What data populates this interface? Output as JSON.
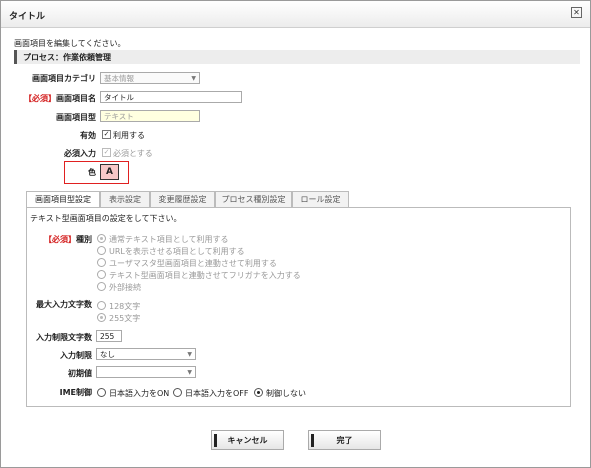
{
  "dialog": {
    "title": "タイトル"
  },
  "instructions": "画面項目を編集してください。",
  "section_title": "プロセス：作業依頼管理",
  "form": {
    "category": {
      "label": "画面項目カテゴリ",
      "value": "基本情報"
    },
    "name": {
      "required": "【必須】",
      "label": "画面項目名",
      "value": "タイトル"
    },
    "type": {
      "label": "画面項目型",
      "value": "テキスト"
    },
    "enabled": {
      "label": "有効",
      "option": "利用する"
    },
    "required_input": {
      "label": "必須入力",
      "option": "必須とする"
    },
    "color": {
      "label": "色",
      "button": "A"
    }
  },
  "tabs": [
    "画面項目型設定",
    "表示設定",
    "変更履歴設定",
    "プロセス種別設定",
    "ロール設定"
  ],
  "panel": {
    "description": "テキスト型画面項目の設定をして下さい。",
    "kind": {
      "required": "【必須】",
      "label": "種別",
      "options": [
        "通常テキスト項目として利用する",
        "URLを表示させる項目として利用する",
        "ユーザマスタ型画面項目と連動させて利用する",
        "テキスト型画面項目と連動させてフリガナを入力する",
        "外部接続"
      ]
    },
    "max_len": {
      "label": "最大入力文字数",
      "options": [
        "128文字",
        "255文字"
      ]
    },
    "limit_len": {
      "label": "入力制限文字数",
      "value": "255"
    },
    "input_limit": {
      "label": "入力制限",
      "value": "なし"
    },
    "initial": {
      "label": "初期値",
      "value": ""
    },
    "ime": {
      "label": "IME制御",
      "options": [
        "日本語入力をON",
        "日本語入力をOFF",
        "制御しない"
      ]
    }
  },
  "buttons": {
    "cancel": "キャンセル",
    "done": "完了"
  },
  "colors": {
    "required": "#d42020",
    "color_swatch": "#f7c8c8",
    "highlight_border": "#e02020"
  }
}
